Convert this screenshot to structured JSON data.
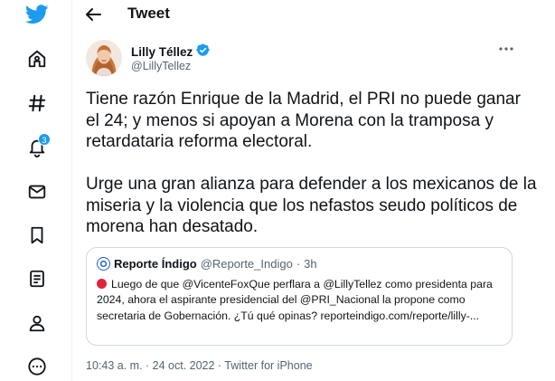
{
  "colors": {
    "brand": "#1d9bf0",
    "text": "#0f1419",
    "secondary": "#536471",
    "border": "#cfd9de",
    "alert": "#e0243b"
  },
  "nav": {
    "items": [
      {
        "name": "twitter-logo-icon"
      },
      {
        "name": "home-icon"
      },
      {
        "name": "explore-hashtag-icon"
      },
      {
        "name": "notifications-bell-icon",
        "badge": "3"
      },
      {
        "name": "messages-envelope-icon"
      },
      {
        "name": "bookmarks-icon"
      },
      {
        "name": "lists-icon"
      },
      {
        "name": "profile-icon"
      },
      {
        "name": "more-circle-icon"
      }
    ]
  },
  "header": {
    "title": "Tweet",
    "back_icon": "arrow-left-icon"
  },
  "tweet": {
    "author": {
      "name": "Lilly Téllez",
      "handle": "@LillyTellez",
      "verified": true
    },
    "more_icon": "more-horizontal-icon",
    "text": "Tiene razón Enrique de la Madrid, el PRI no puede ganar el 24; y menos si apoyan a Morena con la tramposa y retardataria reforma electoral.\n\nUrge una gran alianza para defender a los mexicanos de la miseria y la violencia que los nefastos seudo políticos de morena han desatado.",
    "quote": {
      "name": "Reporte Índigo",
      "handle": "@Reporte_Indigo",
      "separator": "·",
      "time": "3h",
      "text": "Luego de que @VicenteFoxQue perflara a @LillyTellez como presidenta para 2024, ahora el aspirante presidencial del @PRI_Nacional la propone como secretaria de Gobernación. ¿Tú qué opinas? reporteindigo.com/reporte/lilly-..."
    },
    "meta": "10:43 a. m. · 24 oct. 2022 · Twitter for iPhone"
  }
}
